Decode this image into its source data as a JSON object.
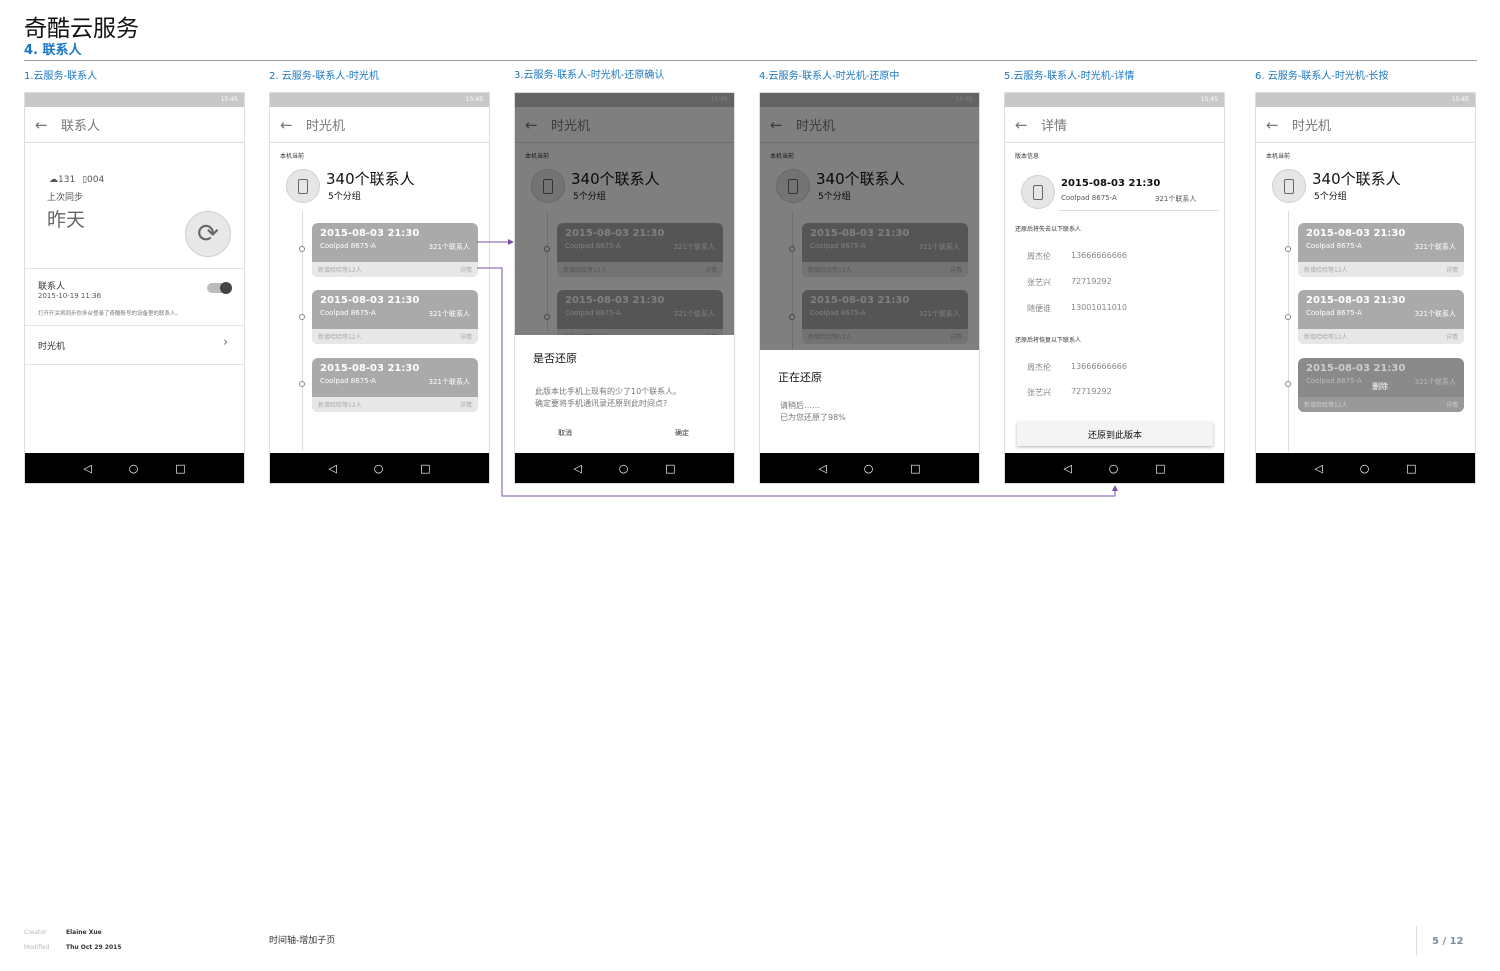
{
  "header": {
    "title": "奇酷云服务",
    "subtitle": "4. 联系人"
  },
  "captions": [
    "1.云服务-联系人",
    "2. 云服务-联系人-时光机",
    "3.云服务-联系人-时光机-还原确认",
    "4.云服务-联系人-时光机-还原中",
    "5.云服务-联系人-时光机-详情",
    "6. 云服务-联系人-时光机-长按"
  ],
  "status_time": "15:45",
  "nav": {
    "back": "◁",
    "home": "○",
    "recent": "□"
  },
  "screen1": {
    "title": "联系人",
    "cloud_count": "131",
    "phone_count": "004",
    "last_sync_label": "上次同步",
    "last_sync_value": "昨天",
    "contacts_label": "联系人",
    "contacts_date": "2015-10-19  11:36",
    "note": "打开开关将同步你多台登录了奇酷账号的设备里的联系人。",
    "timemachine": "时光机"
  },
  "timeline": {
    "title": "时光机",
    "current_label": "本机当前",
    "count": "340个联系人",
    "groups": "5个分组",
    "cards": [
      {
        "date": "2015-08-03  21:30",
        "device": "Coolpad 8675-A",
        "contacts": "321个联系人",
        "added": "新增哈哈等12人",
        "detail": "详情"
      },
      {
        "date": "2015-08-03  21:30",
        "device": "Coolpad 8675-A",
        "contacts": "321个联系人",
        "added": "新增哈哈等12人",
        "detail": "详情"
      },
      {
        "date": "2015-08-03  21:30",
        "device": "Coolpad 8675-A",
        "contacts": "321个联系人",
        "added": "新增哈哈等12人",
        "detail": "详情"
      }
    ]
  },
  "screen3": {
    "dialog_title": "是否还原",
    "line1": "此版本比手机上现有的少了10个联系人。",
    "line2": "确定要将手机通讯录还原到此时间点?",
    "cancel": "取消",
    "confirm": "确定"
  },
  "screen4": {
    "title": "正在还原",
    "line1": "请稍后……",
    "line2": "已为您还原了98%"
  },
  "screen5": {
    "title": "详情",
    "version_label": "版本信息",
    "date": "2015-08-03  21:30",
    "device": "Coolpad 8675-A",
    "contacts": "321个联系人",
    "lost_label": "还原后将失去以下联系人",
    "lost": [
      {
        "name": "周杰伦",
        "phone": "13666666666"
      },
      {
        "name": "张艺兴",
        "phone": "72719292"
      },
      {
        "name": "随便谁",
        "phone": "13001011010"
      }
    ],
    "restore_label": "还原后将恢复以下联系人",
    "restore": [
      {
        "name": "周杰伦",
        "phone": "13666666666"
      },
      {
        "name": "张艺兴",
        "phone": "72719292"
      }
    ],
    "button": "还原到此版本"
  },
  "screen6": {
    "delete": "删除"
  },
  "footer": {
    "creator_label": "Creator",
    "creator": "Elaine Xue",
    "modified_label": "Modified",
    "modified": "Thu Oct 29 2015",
    "page_title": "时间轴-增加子页",
    "page": "5 / 12"
  },
  "colors": {
    "accent": "#1a76c2",
    "link": "#7b4fa8"
  }
}
